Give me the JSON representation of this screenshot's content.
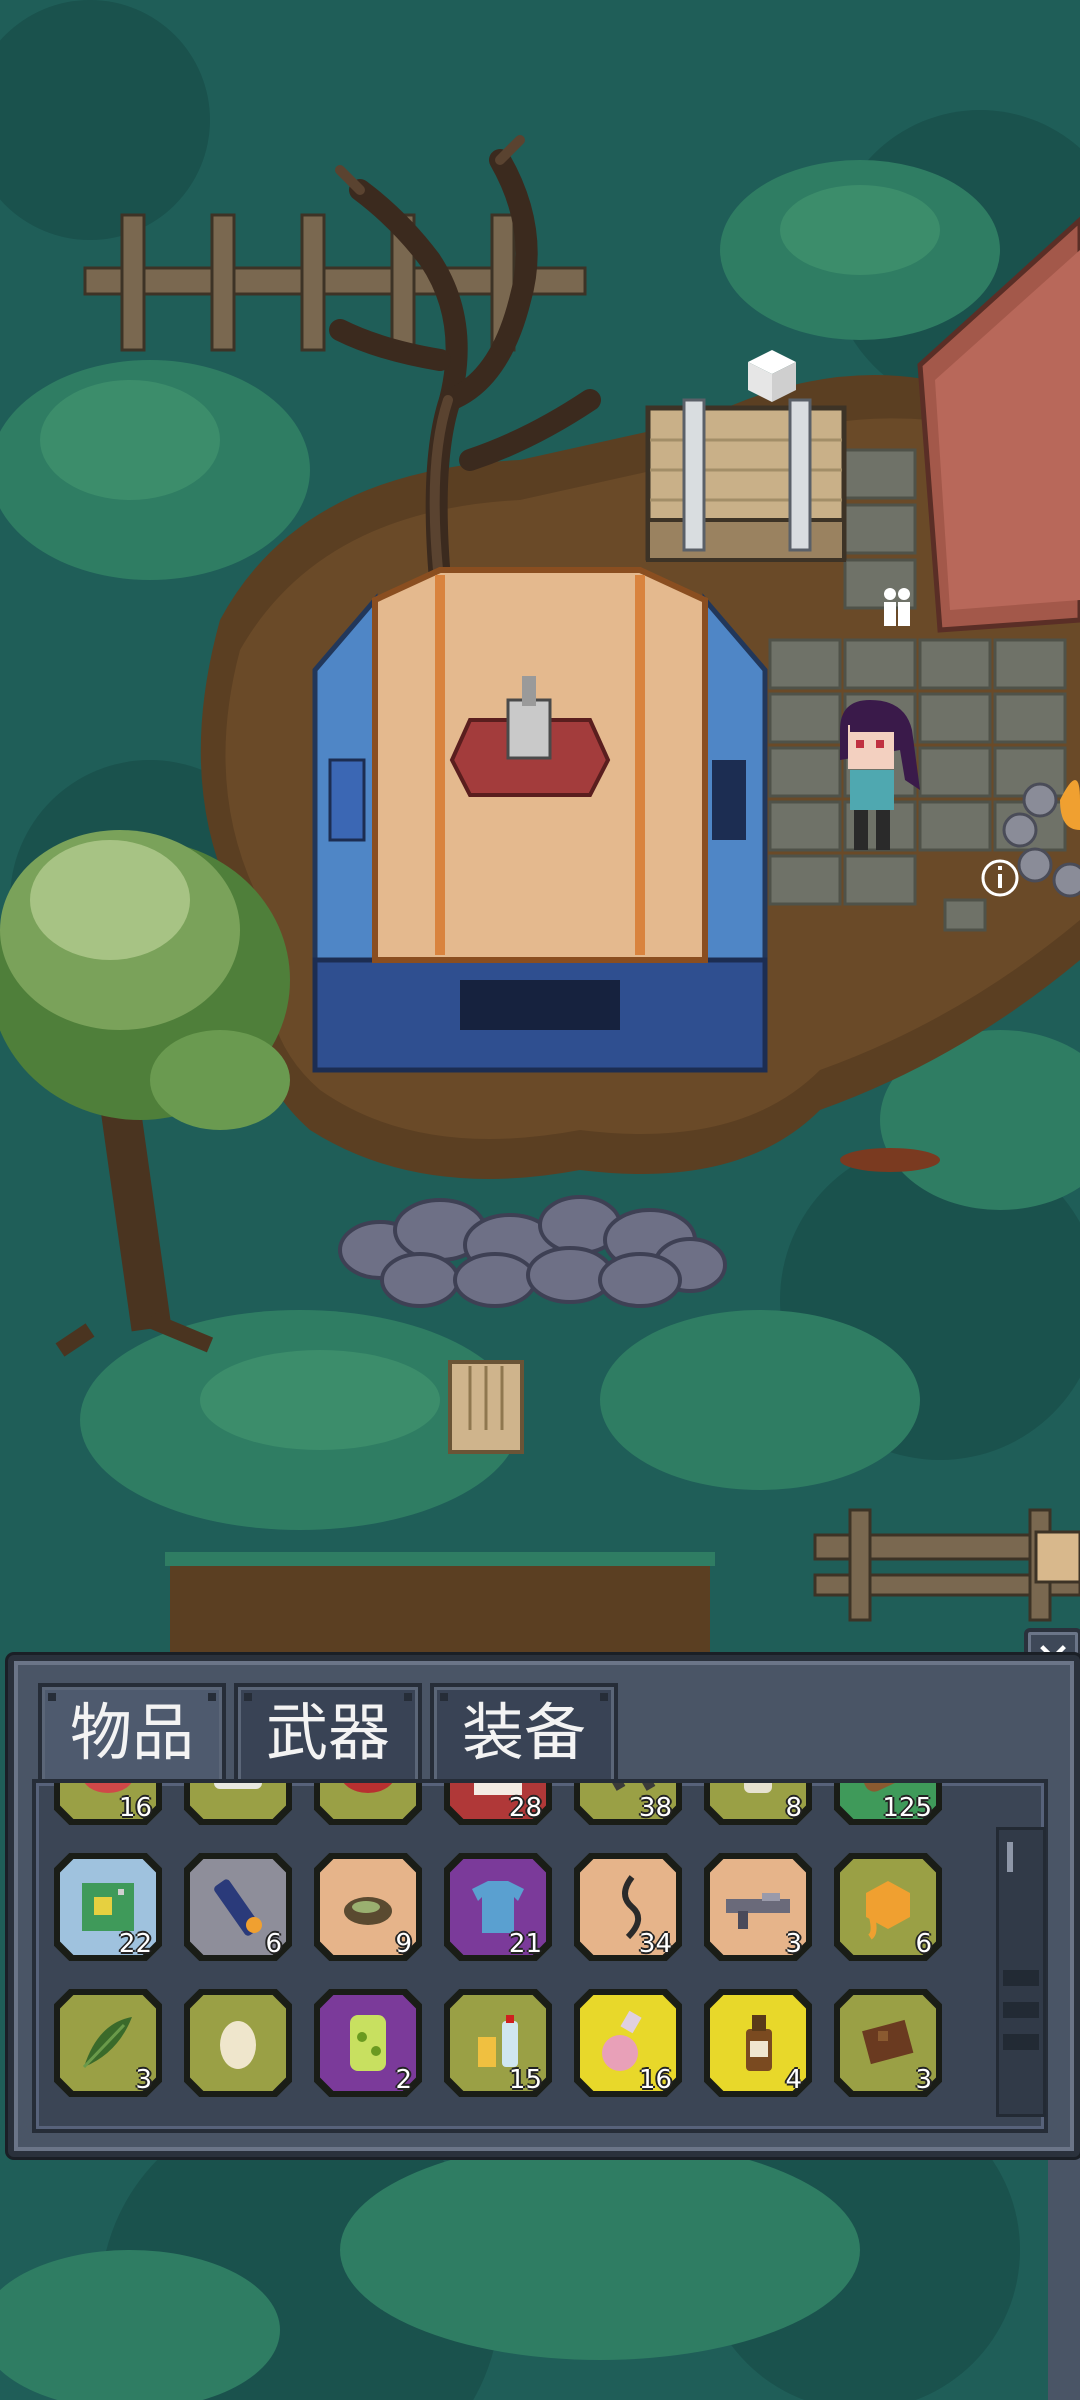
{
  "inventory": {
    "tabs": [
      {
        "label": "物品",
        "active": true
      },
      {
        "label": "武器",
        "active": false
      },
      {
        "label": "装备",
        "active": false
      }
    ],
    "close_icon": "close-icon",
    "rows": [
      [
        {
          "icon": "raw-meat-icon",
          "count": "16",
          "bg": "olive"
        },
        {
          "icon": "cloth-icon",
          "count": "",
          "bg": "olive"
        },
        {
          "icon": "steak-icon",
          "count": "",
          "bg": "olive"
        },
        {
          "icon": "medkit-icon",
          "count": "28",
          "bg": "red"
        },
        {
          "icon": "scissors-icon",
          "count": "38",
          "bg": "olive"
        },
        {
          "icon": "jar-icon",
          "count": "8",
          "bg": "olive"
        },
        {
          "icon": "wood-log-icon",
          "count": "125",
          "bg": "green"
        }
      ],
      [
        {
          "icon": "circuit-board-icon",
          "count": "22",
          "bg": "lightblue"
        },
        {
          "icon": "battery-icon",
          "count": "6",
          "bg": "gray"
        },
        {
          "icon": "food-bowl-icon",
          "count": "9",
          "bg": "peach"
        },
        {
          "icon": "tshirt-icon",
          "count": "21",
          "bg": "purple"
        },
        {
          "icon": "rope-icon",
          "count": "34",
          "bg": "peach"
        },
        {
          "icon": "rifle-icon",
          "count": "3",
          "bg": "peach"
        },
        {
          "icon": "honeycomb-icon",
          "count": "6",
          "bg": "olive"
        }
      ],
      [
        {
          "icon": "herb-leaf-icon",
          "count": "3",
          "bg": "olive"
        },
        {
          "icon": "egg-icon",
          "count": "",
          "bg": "olive"
        },
        {
          "icon": "glowing-can-icon",
          "count": "2",
          "bg": "purple"
        },
        {
          "icon": "water-bottles-icon",
          "count": "15",
          "bg": "olive"
        },
        {
          "icon": "potion-flask-icon",
          "count": "16",
          "bg": "yellow"
        },
        {
          "icon": "medicine-bottle-icon",
          "count": "4",
          "bg": "yellow"
        },
        {
          "icon": "chocolate-icon",
          "count": "3",
          "bg": "olive"
        }
      ]
    ]
  },
  "colors": {
    "olive": "#9aa045",
    "green": "#3f9a5a",
    "red": "#b03838",
    "lightblue": "#9fc2de",
    "gray": "#8e8e9a",
    "peach": "#e6b48a",
    "purple": "#7b3a9a",
    "yellow": "#e8d82a"
  }
}
